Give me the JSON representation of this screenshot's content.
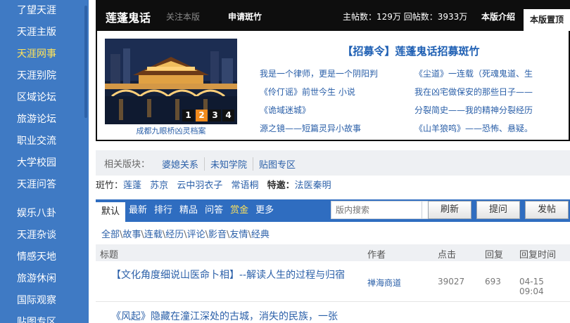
{
  "sidebar": {
    "items": [
      {
        "label": "了望天涯"
      },
      {
        "label": "天涯主版"
      },
      {
        "label": "天涯网事"
      },
      {
        "label": "天涯别院"
      },
      {
        "label": "区域论坛"
      },
      {
        "label": "旅游论坛"
      },
      {
        "label": "职业交流"
      },
      {
        "label": "大学校园"
      },
      {
        "label": "天涯问答"
      },
      {
        "label": "娱乐八卦"
      },
      {
        "label": "天涯杂谈"
      },
      {
        "label": "情感天地"
      },
      {
        "label": "旅游休闲"
      },
      {
        "label": "国际观察"
      },
      {
        "label": "贴图专区"
      }
    ],
    "active_index": 2
  },
  "header": {
    "forum_title": "莲蓬鬼话",
    "follow_label": "关注本版",
    "apply_label": "申请斑竹",
    "stats": "主帖数：129万 回帖数：3933万",
    "tabs": {
      "intro": "本版介绍",
      "top": "本版置顶"
    }
  },
  "featured": {
    "caption": "成都九眼桥凶灵档案",
    "pager": [
      "1",
      "2",
      "3",
      "4"
    ],
    "pager_active": 1,
    "headline": "【招募令】莲蓬鬼话招募斑竹",
    "links": [
      [
        "我是一个律师，更是一个阴阳判",
        "《尘道》一连载（死魂鬼道、生"
      ],
      [
        "《伶仃谣》前世今生 小说",
        "我在凶宅做保安的那些日子——"
      ],
      [
        "《诡域迷城》",
        "分裂简史——我的精神分裂经历"
      ],
      [
        "源之镜——短篇灵异小故事",
        "《山羊狼鸣》——恐怖、悬疑。"
      ]
    ]
  },
  "related": {
    "label": "相关版块：",
    "items": [
      "婆媳关系",
      "未知学院",
      "贴图专区"
    ]
  },
  "moderators": {
    "label": "斑竹：",
    "names": [
      "莲蓬",
      "苏京",
      "云中羽衣子",
      "常语桐"
    ],
    "special_label": "特邀：",
    "special_names": [
      "法医秦明"
    ]
  },
  "toolbar": {
    "tabs": [
      "默认",
      "最新",
      "排行",
      "精品",
      "问答",
      "赏金",
      "更多"
    ],
    "search_placeholder": "版内搜索",
    "refresh": "刷新",
    "ask": "提问",
    "post": "发帖"
  },
  "breadcrumb": [
    "全部",
    "故事",
    "连载",
    "经历",
    "评论",
    "影音",
    "友情",
    "经典"
  ],
  "table": {
    "headers": {
      "title": "标题",
      "author": "作者",
      "clicks": "点击",
      "replies": "回复",
      "reply_time": "回复时间"
    },
    "rows": [
      {
        "title": "【文化角度细说山医命卜相】--解读人生的过程与归宿",
        "author": "禅海商道",
        "clicks": "39027",
        "replies": "693",
        "time": "04-15 09:04"
      },
      {
        "title": "《风起》隐藏在潼江深处的古城，消失的民族，一张",
        "author": "",
        "clicks": "",
        "replies": "",
        "time": ""
      }
    ]
  },
  "colors": {
    "sidebar_bg": "#3f7ac4",
    "header_bg": "#0e0e0e",
    "toolbar_bg": "#2f6dc0",
    "link": "#2a5fa8",
    "accent_gold": "#ffe35a",
    "pager_active": "#f08a1c"
  }
}
